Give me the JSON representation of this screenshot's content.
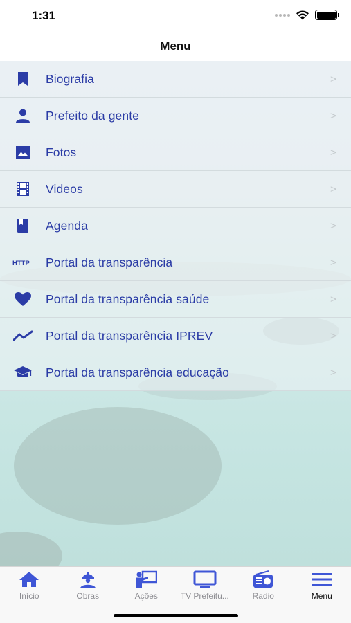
{
  "status_bar": {
    "time": "1:31"
  },
  "nav": {
    "title": "Menu"
  },
  "menu": {
    "items": [
      {
        "label": "Biografia",
        "icon": "bookmark-icon"
      },
      {
        "label": "Prefeito da gente",
        "icon": "person-icon"
      },
      {
        "label": "Fotos",
        "icon": "image-icon"
      },
      {
        "label": "Videos",
        "icon": "film-icon"
      },
      {
        "label": "Agenda",
        "icon": "book-icon"
      },
      {
        "label": "Portal da transparência",
        "icon": "http-icon"
      },
      {
        "label": "Portal da transparência saúde",
        "icon": "heart-icon"
      },
      {
        "label": "Portal da transparência IPREV",
        "icon": "trending-icon"
      },
      {
        "label": "Portal da transparência educação",
        "icon": "graduation-cap-icon"
      }
    ],
    "chevron": ">"
  },
  "tab_bar": {
    "tabs": [
      {
        "label": "Início",
        "icon": "home-icon",
        "active": false
      },
      {
        "label": "Obras",
        "icon": "worker-icon",
        "active": false
      },
      {
        "label": "Ações",
        "icon": "presentation-icon",
        "active": false
      },
      {
        "label": "TV Prefeitu...",
        "icon": "tv-icon",
        "active": false
      },
      {
        "label": "Radio",
        "icon": "radio-icon",
        "active": false
      },
      {
        "label": "Menu",
        "icon": "menu-icon",
        "active": true
      }
    ]
  },
  "colors": {
    "accent": "#2b3ca6",
    "tab_inactive": "#8e8e93",
    "tab_icon": "#3f56d6"
  }
}
